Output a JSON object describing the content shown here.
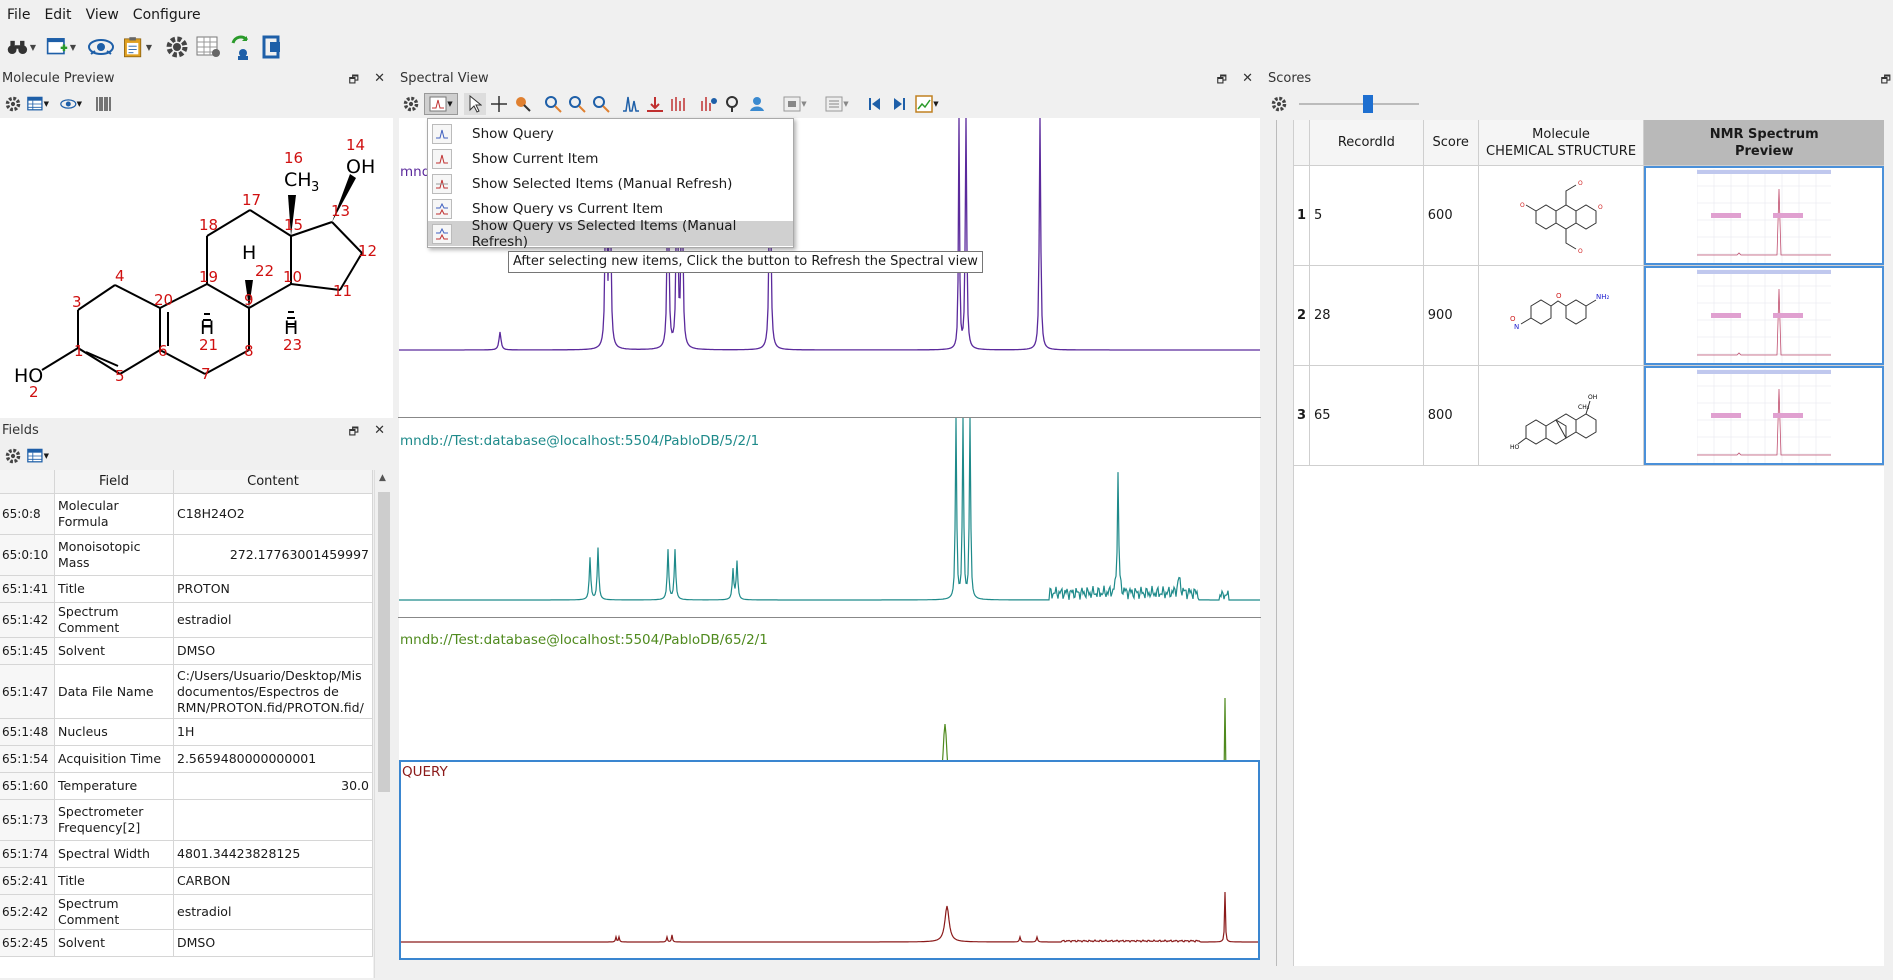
{
  "menu": [
    "File",
    "Edit",
    "View",
    "Configure"
  ],
  "panels": {
    "molecule_preview": "Molecule Preview",
    "fields": "Fields",
    "spectral_view": "Spectral View",
    "scores": "Scores"
  },
  "molecule": {
    "atoms": [
      "1",
      "2",
      "3",
      "4",
      "5",
      "6",
      "7",
      "8",
      "9",
      "10",
      "11",
      "12",
      "13",
      "14",
      "15",
      "16",
      "17",
      "18",
      "19",
      "20",
      "21",
      "22",
      "23"
    ],
    "groups": {
      "oh_top": "OH",
      "ho_left": "HO",
      "ch3": "CH",
      "ch3_sub": "3",
      "h": "H"
    }
  },
  "fields": {
    "headers": [
      "Field",
      "Content"
    ],
    "rows": [
      {
        "id": "65:0:8",
        "field": "Molecular Formula",
        "content": "C18H24O2",
        "num": false
      },
      {
        "id": "65:0:10",
        "field": "Monoisotopic Mass",
        "content": "272.17763001459997",
        "num": true
      },
      {
        "id": "65:1:41",
        "field": "Title",
        "content": "PROTON",
        "num": false
      },
      {
        "id": "65:1:42",
        "field": "Spectrum Comment",
        "content": "estradiol",
        "num": false
      },
      {
        "id": "65:1:45",
        "field": "Solvent",
        "content": "DMSO",
        "num": false
      },
      {
        "id": "65:1:47",
        "field": "Data File Name",
        "content": "C:/Users/Usuario/Desktop/Mis documentos/Espectros de RMN/PROTON.fid/PROTON.fid/",
        "num": false
      },
      {
        "id": "65:1:48",
        "field": "Nucleus",
        "content": "1H",
        "num": false
      },
      {
        "id": "65:1:54",
        "field": "Acquisition Time",
        "content": "2.5659480000000001",
        "num": false
      },
      {
        "id": "65:1:60",
        "field": "Temperature",
        "content": "30.0",
        "num": true
      },
      {
        "id": "65:1:73",
        "field": "Spectrometer Frequency[2]",
        "content": "",
        "num": false
      },
      {
        "id": "65:1:74",
        "field": "Spectral Width",
        "content": "4801.34423828125",
        "num": false
      },
      {
        "id": "65:2:41",
        "field": "Title",
        "content": "CARBON",
        "num": false
      },
      {
        "id": "65:2:42",
        "field": "Spectrum Comment",
        "content": "estradiol",
        "num": false
      },
      {
        "id": "65:2:45",
        "field": "Solvent",
        "content": "DMSO",
        "num": false
      }
    ]
  },
  "spectral": {
    "label_top": "mnd",
    "label2": "mndb://Test:database@localhost:5504/PabloDB/5/2/1",
    "label3": "mndb://Test:database@localhost:5504/PabloDB/65/2/1",
    "label_query": "QUERY",
    "colors": {
      "s1": "#5b2a9c",
      "s2": "#1e8a8a",
      "s3": "#4f8a1e",
      "query": "#8b1a1a"
    }
  },
  "dropdown": {
    "items": [
      "Show Query",
      "Show Current Item",
      "Show Selected Items (Manual Refresh)",
      "Show Query vs Current Item",
      "Show Query vs Selected Items (Manual Refresh)"
    ],
    "tooltip": "After selecting new items, Click the button to Refresh the Spectral view"
  },
  "scores": {
    "headers": {
      "record": "RecordId",
      "score": "Score",
      "molecule": "Molecule",
      "molecule_sub": "CHEMICAL STRUCTURE",
      "nmr": "NMR Spectrum",
      "nmr_sub": "Preview"
    },
    "rows": [
      {
        "idx": "1",
        "record": "5",
        "score": "600"
      },
      {
        "idx": "2",
        "record": "28",
        "score": "900"
      },
      {
        "idx": "3",
        "record": "65",
        "score": "800"
      }
    ]
  }
}
